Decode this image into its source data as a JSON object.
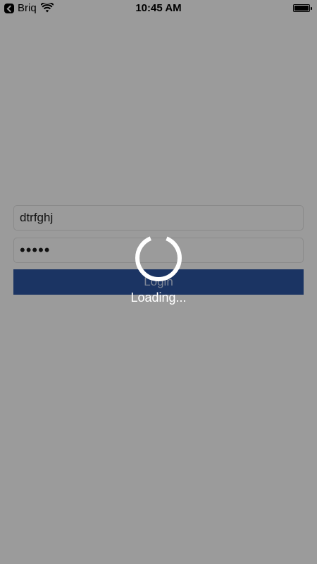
{
  "status_bar": {
    "back_app": "Briq",
    "time": "10:45 AM"
  },
  "login_form": {
    "username_value": "dtrfghj",
    "password_value": "•••••",
    "login_label": "Login"
  },
  "overlay": {
    "loading_text": "Loading..."
  },
  "colors": {
    "background": "#9b9b9b",
    "login_button": "#1b3463",
    "spinner": "#ffffff"
  }
}
